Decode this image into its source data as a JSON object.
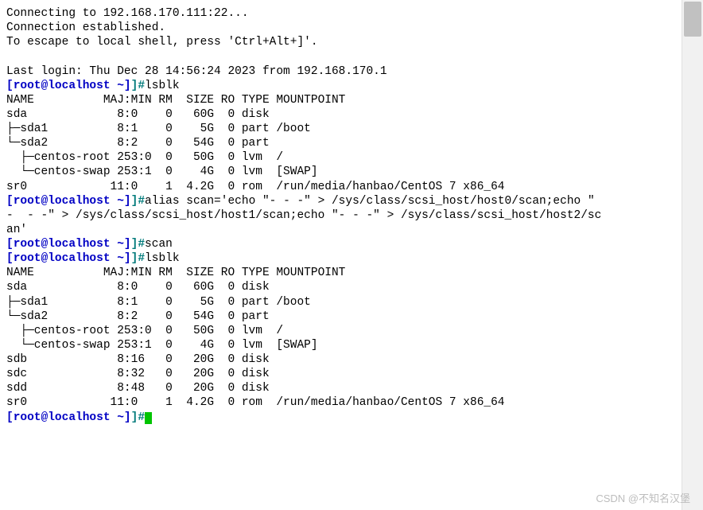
{
  "session": {
    "connecting": "Connecting to 192.168.170.111:22...",
    "established": "Connection established.",
    "escape_hint": "To escape to local shell, press 'Ctrl+Alt+]'.",
    "last_login": "Last login: Thu Dec 28 14:56:24 2023 from 192.168.170.1"
  },
  "prompt": {
    "open": "[",
    "user": "root@localhost",
    "path": " ~]",
    "close": "]#"
  },
  "cmds": {
    "lsblk1": "lsblk",
    "alias_line1": "alias scan='echo \"- - -\" > /sys/class/scsi_host/host0/scan;echo \"",
    "alias_line2": "-  - -\" > /sys/class/scsi_host/host1/scan;echo \"- - -\" > /sys/class/scsi_host/host2/sc",
    "alias_line3": "an'",
    "scan": "scan",
    "lsblk2": "lsblk"
  },
  "lsblk_header": "NAME          MAJ:MIN RM  SIZE RO TYPE MOUNTPOINT",
  "lsblk1": {
    "rows": [
      "sda             8:0    0   60G  0 disk ",
      "├─sda1          8:1    0    5G  0 part /boot",
      "└─sda2          8:2    0   54G  0 part ",
      "  ├─centos-root 253:0  0   50G  0 lvm  /",
      "  └─centos-swap 253:1  0    4G  0 lvm  [SWAP]",
      "sr0            11:0    1  4.2G  0 rom  /run/media/hanbao/CentOS 7 x86_64"
    ]
  },
  "lsblk2": {
    "rows": [
      "sda             8:0    0   60G  0 disk ",
      "├─sda1          8:1    0    5G  0 part /boot",
      "└─sda2          8:2    0   54G  0 part ",
      "  ├─centos-root 253:0  0   50G  0 lvm  /",
      "  └─centos-swap 253:1  0    4G  0 lvm  [SWAP]",
      "sdb             8:16   0   20G  0 disk ",
      "sdc             8:32   0   20G  0 disk ",
      "sdd             8:48   0   20G  0 disk ",
      "sr0            11:0    1  4.2G  0 rom  /run/media/hanbao/CentOS 7 x86_64"
    ]
  },
  "watermark": "CSDN @不知名汉堡"
}
